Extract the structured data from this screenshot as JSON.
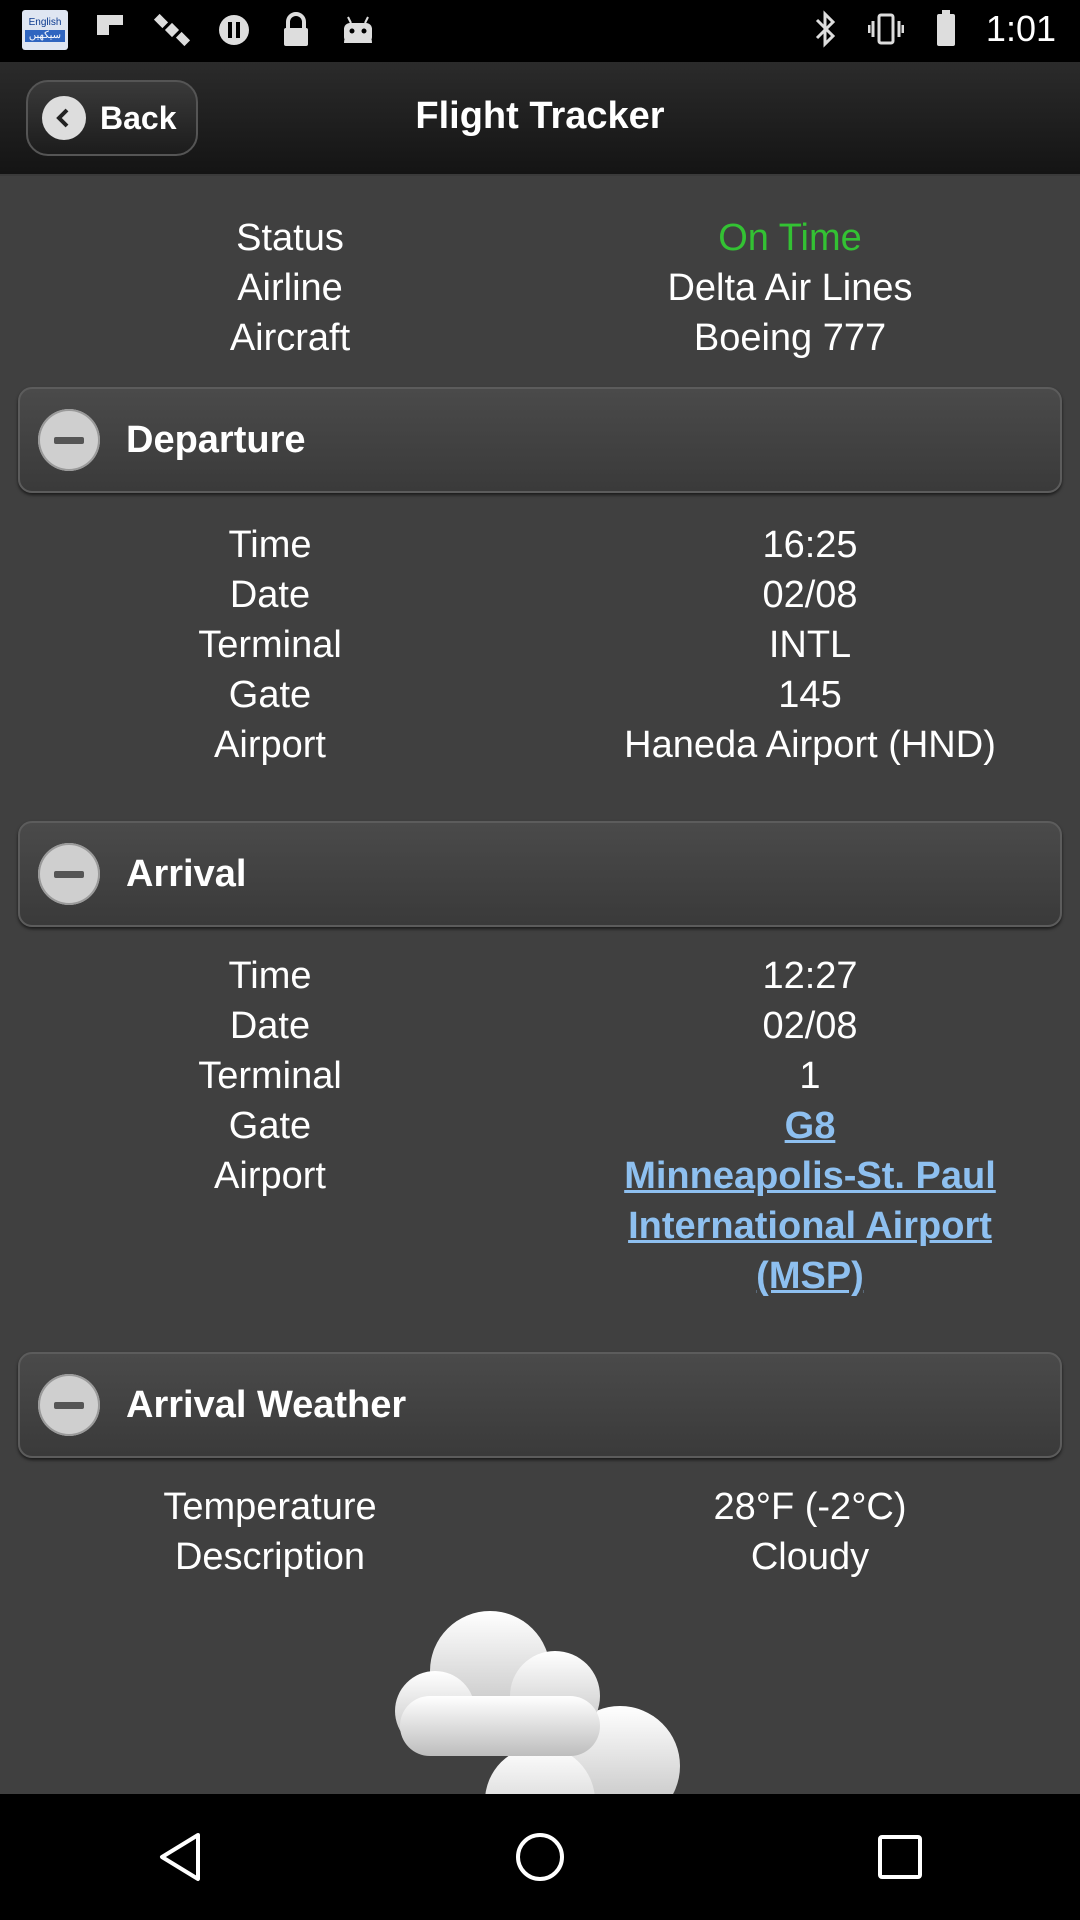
{
  "status_bar": {
    "lang_top": "English",
    "lang_bottom": "سیکھیں",
    "time": "1:01"
  },
  "header": {
    "back_label": "Back",
    "title": "Flight Tracker"
  },
  "summary": [
    {
      "key": "Status",
      "value": "On Time"
    },
    {
      "key": "Airline",
      "value": "Delta Air Lines"
    },
    {
      "key": "Aircraft",
      "value": "Boeing 777"
    }
  ],
  "departure": {
    "label": "Departure",
    "rows": [
      {
        "key": "Time",
        "value": "16:25"
      },
      {
        "key": "Date",
        "value": "02/08"
      },
      {
        "key": "Terminal",
        "value": "INTL"
      },
      {
        "key": "Gate",
        "value": "145"
      },
      {
        "key": "Airport",
        "value": "Haneda Airport (HND)"
      }
    ]
  },
  "arrival": {
    "label": "Arrival",
    "rows": [
      {
        "key": "Time",
        "value": "12:27"
      },
      {
        "key": "Date",
        "value": "02/08"
      },
      {
        "key": "Terminal",
        "value": "1"
      },
      {
        "key": "Gate",
        "value": "G8"
      },
      {
        "key": "Airport",
        "value": "Minneapolis-St. Paul International Airport (MSP)"
      }
    ]
  },
  "arrival_weather": {
    "label": "Arrival Weather",
    "rows": [
      {
        "key": "Temperature",
        "value": "28°F (-2°C)"
      },
      {
        "key": "Description",
        "value": "Cloudy"
      }
    ],
    "icon": "cloudy-icon"
  },
  "colors": {
    "status_on_time": "#33c233",
    "link": "#8ec0f0",
    "background": "#404040"
  },
  "icons": [
    "lang-badge-icon",
    "flipboard-icon",
    "satellite-icon",
    "pause-icon",
    "lock-icon",
    "android-icon",
    "bluetooth-icon",
    "back-arrow-icon",
    "minus-circle-icon",
    "cloudy-icon",
    "nav-back-icon",
    "nav-home-icon",
    "nav-recents-icon"
  ]
}
